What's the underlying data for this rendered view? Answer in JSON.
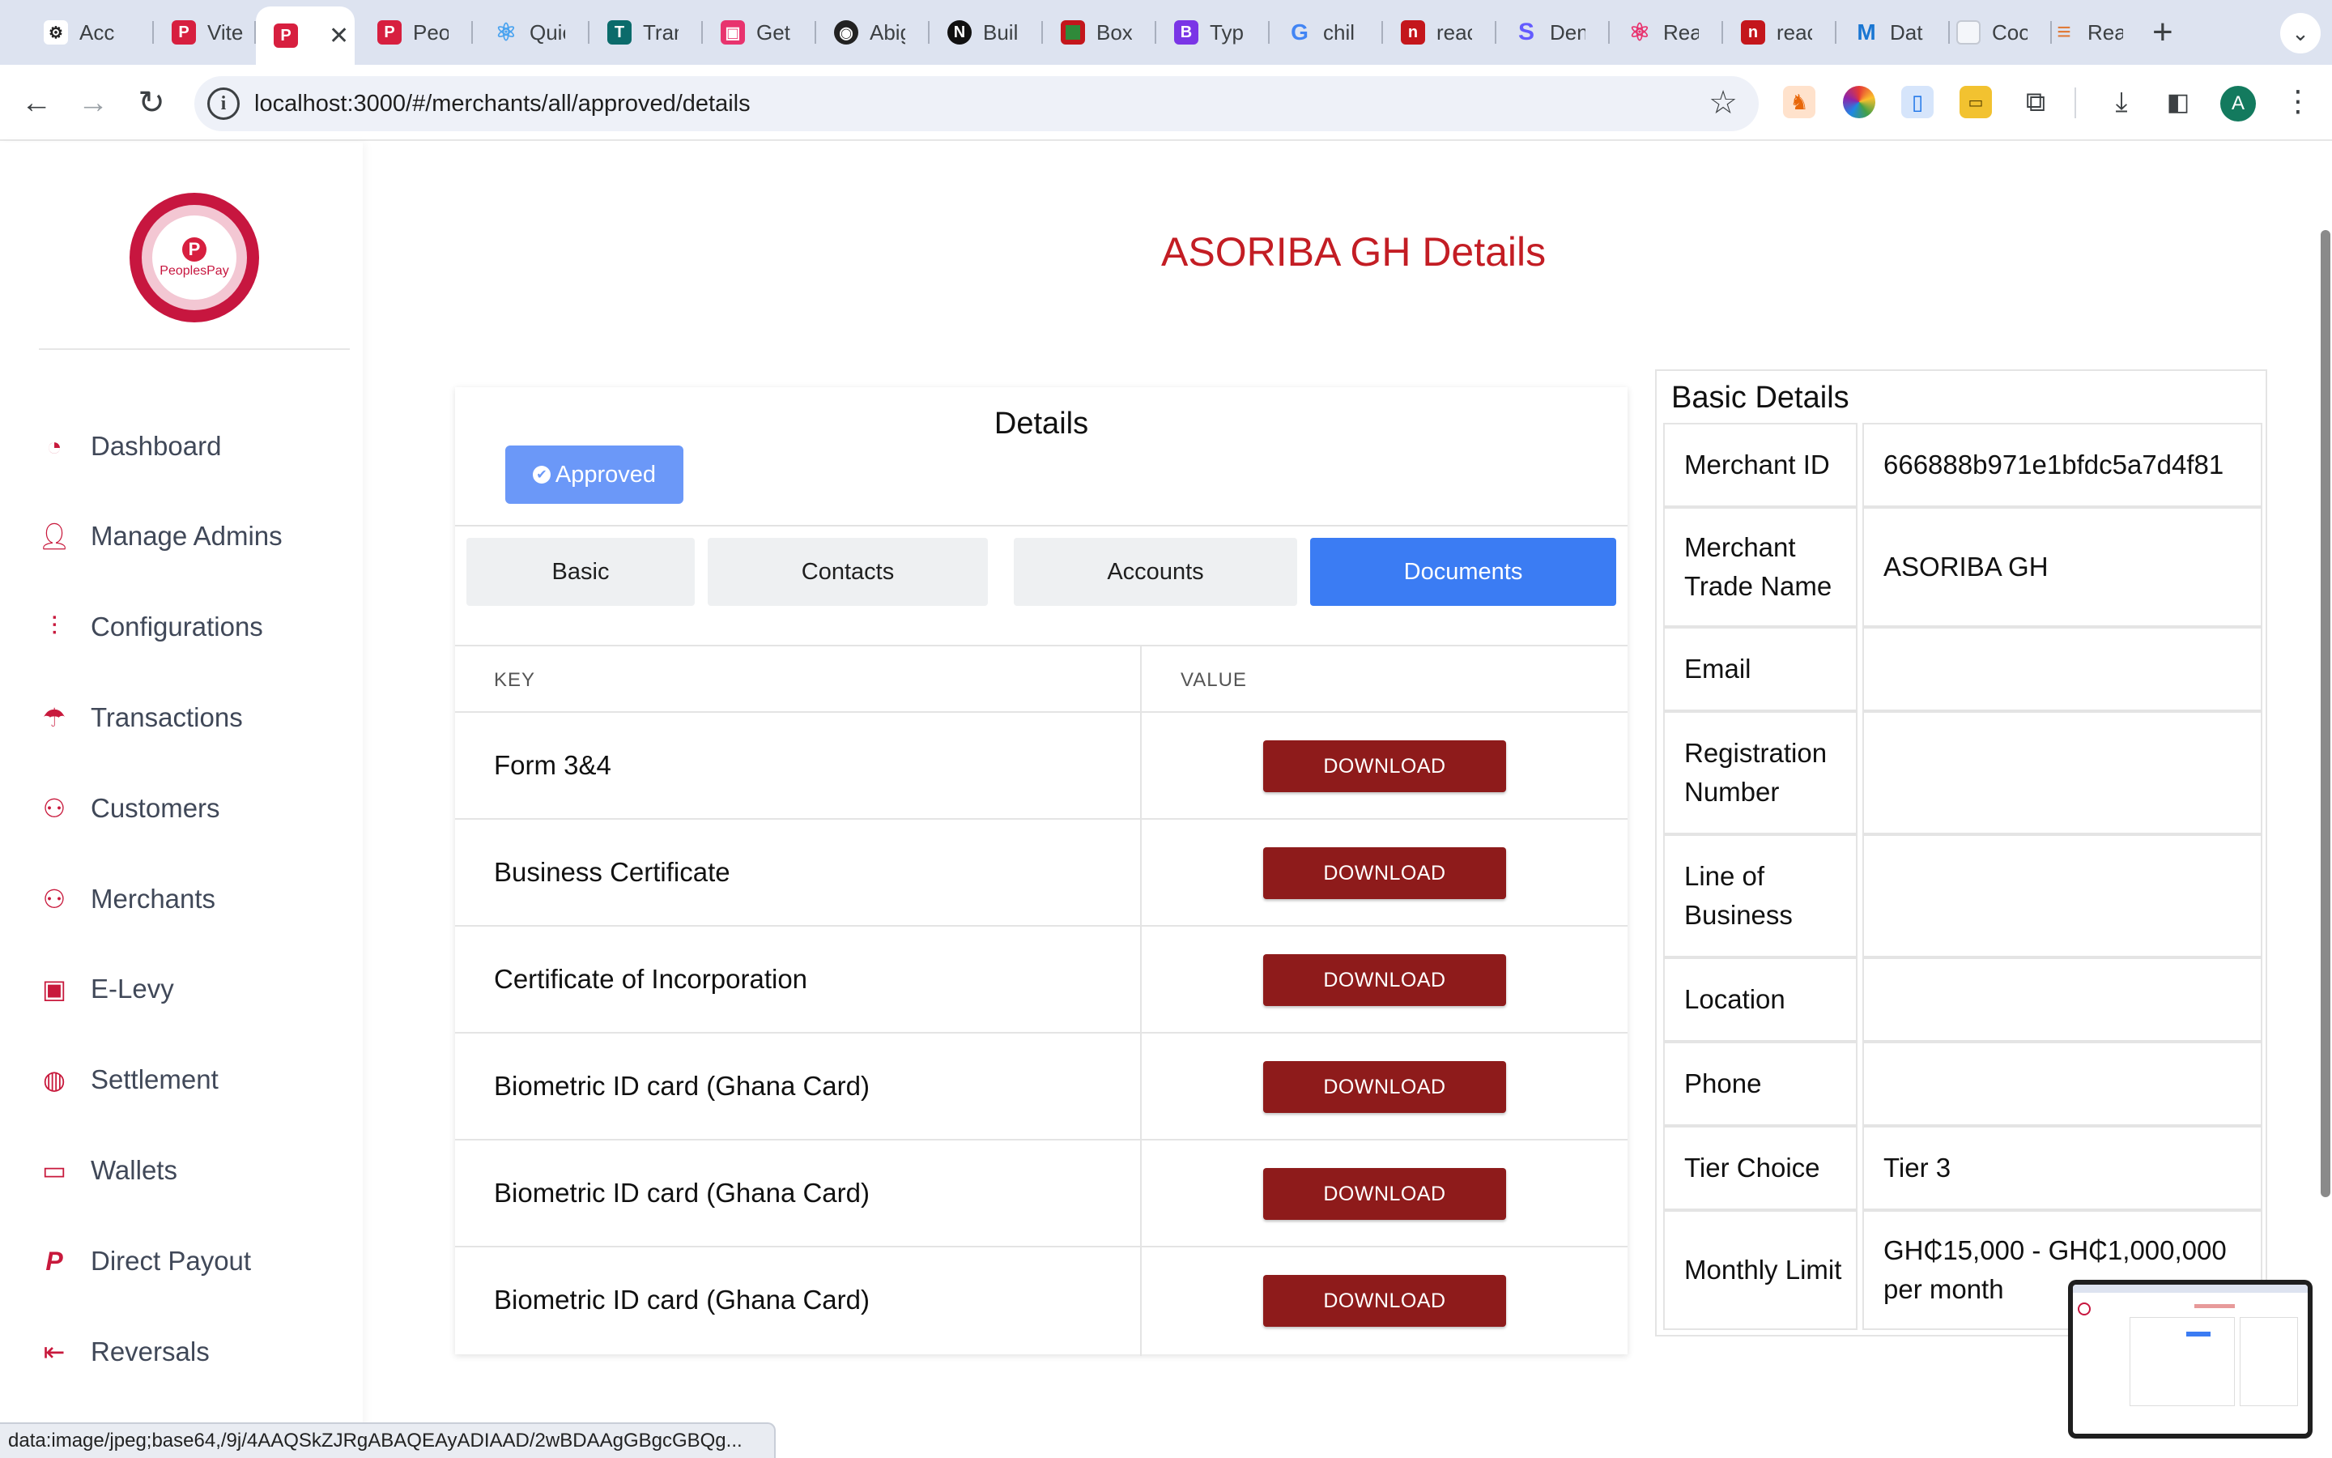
{
  "browser": {
    "tabs": [
      {
        "label": "Acc",
        "icon": "openai-icon",
        "color": "#222222",
        "glyph": "⚙"
      },
      {
        "label": "Vite",
        "icon": "peoplespay-icon",
        "color": "#d71f3f",
        "glyph": "P"
      },
      {
        "label": "",
        "icon": "peoplespay-icon",
        "color": "#d71f3f",
        "glyph": "P",
        "active": true
      },
      {
        "label": "Peo",
        "icon": "peoplespay-icon",
        "color": "#d71f3f",
        "glyph": "P"
      },
      {
        "label": "Quic",
        "icon": "react-icon",
        "color": "#4aa3ef",
        "glyph": "⚛"
      },
      {
        "label": "Tran",
        "icon": "tran-icon",
        "color": "#0b6b6b",
        "glyph": "T"
      },
      {
        "label": "Get",
        "icon": "get-icon",
        "color": "#e8336e",
        "glyph": "▣"
      },
      {
        "label": "Abig",
        "icon": "github-icon",
        "color": "#222222",
        "glyph": "◉"
      },
      {
        "label": "Buil",
        "icon": "nextjs-icon",
        "color": "#111111",
        "glyph": "N"
      },
      {
        "label": "Box",
        "icon": "box-icon",
        "color": "#2f8a3a",
        "glyph": "■"
      },
      {
        "label": "Typ",
        "icon": "bootstrap-icon",
        "color": "#7a35e6",
        "glyph": "B"
      },
      {
        "label": "chil",
        "icon": "google-icon",
        "color": "#4285f4",
        "glyph": "G"
      },
      {
        "label": "reac",
        "icon": "npm-icon",
        "color": "#c4161c",
        "glyph": "n"
      },
      {
        "label": "Den",
        "icon": "stripe-icon",
        "color": "#635bff",
        "glyph": "S"
      },
      {
        "label": "Rea",
        "icon": "react-icon",
        "color": "#e8336e",
        "glyph": "⚛"
      },
      {
        "label": "reac",
        "icon": "npm-icon",
        "color": "#c4161c",
        "glyph": "n"
      },
      {
        "label": "Dat",
        "icon": "mui-icon",
        "color": "#1976d2",
        "glyph": "M"
      },
      {
        "label": "Coo",
        "icon": "blank-page-icon",
        "color": "#d0d4dc",
        "glyph": ""
      },
      {
        "label": "Rea",
        "icon": "redux-icon",
        "color": "#e07b39",
        "glyph": "≡"
      }
    ],
    "url": "localhost:3000/#/merchants/all/approved/details",
    "new_tab": "+",
    "status_url": "data:image/jpeg;base64,/9j/4AAQSkZJRgABAQEAyADIAAD/2wBDAAgGBgcGBQg...",
    "profile_initial": "A"
  },
  "sidebar": {
    "brand": "PeoplesPay",
    "items": [
      {
        "label": "Dashboard",
        "icon": "dashboard-gauge-icon"
      },
      {
        "label": "Manage Admins",
        "icon": "user-check-icon"
      },
      {
        "label": "Configurations",
        "icon": "sliders-icon"
      },
      {
        "label": "Transactions",
        "icon": "transactions-icon"
      },
      {
        "label": "Customers",
        "icon": "users-icon"
      },
      {
        "label": "Merchants",
        "icon": "users-icon"
      },
      {
        "label": "E-Levy",
        "icon": "money-icon"
      },
      {
        "label": "Settlement",
        "icon": "globe-icon"
      },
      {
        "label": "Wallets",
        "icon": "wallet-icon"
      },
      {
        "label": "Direct Payout",
        "icon": "paypal-icon"
      },
      {
        "label": "Reversals",
        "icon": "reverse-icon"
      }
    ]
  },
  "page": {
    "title": "ASORIBA GH Details"
  },
  "details": {
    "title": "Details",
    "status_badge": "Approved",
    "tabs": [
      "Basic",
      "Contacts",
      "Accounts",
      "Documents"
    ],
    "active_tab": "Documents",
    "table": {
      "headers": [
        "KEY",
        "VALUE"
      ],
      "rows": [
        {
          "key": "Form 3&4",
          "action": "DOWNLOAD"
        },
        {
          "key": "Business Certificate",
          "action": "DOWNLOAD"
        },
        {
          "key": "Certificate of Incorporation",
          "action": "DOWNLOAD"
        },
        {
          "key": "Biometric ID card (Ghana Card)",
          "action": "DOWNLOAD"
        },
        {
          "key": "Biometric ID card (Ghana Card)",
          "action": "DOWNLOAD"
        },
        {
          "key": "Biometric ID card (Ghana Card)",
          "action": "DOWNLOAD"
        }
      ]
    }
  },
  "basic_details": {
    "title": "Basic Details",
    "rows": [
      {
        "key": "Merchant ID",
        "value": "666888b971e1bfdc5a7d4f81"
      },
      {
        "key": "Merchant Trade Name",
        "value": "ASORIBA GH"
      },
      {
        "key": "Email",
        "value": ""
      },
      {
        "key": "Registration Number",
        "value": ""
      },
      {
        "key": "Line of Business",
        "value": ""
      },
      {
        "key": "Location",
        "value": ""
      },
      {
        "key": "Phone",
        "value": ""
      },
      {
        "key": "Tier Choice",
        "value": "Tier 3"
      },
      {
        "key": "Monthly Limit",
        "value": "GH₵15,000 - GH₵1,000,000 per month"
      }
    ]
  },
  "colors": {
    "accent_red": "#c31d24",
    "download_red": "#8e1b1b",
    "primary_blue": "#3b7cf3",
    "badge_blue": "#6b98f8",
    "sidebar_icon": "#c8193c"
  }
}
